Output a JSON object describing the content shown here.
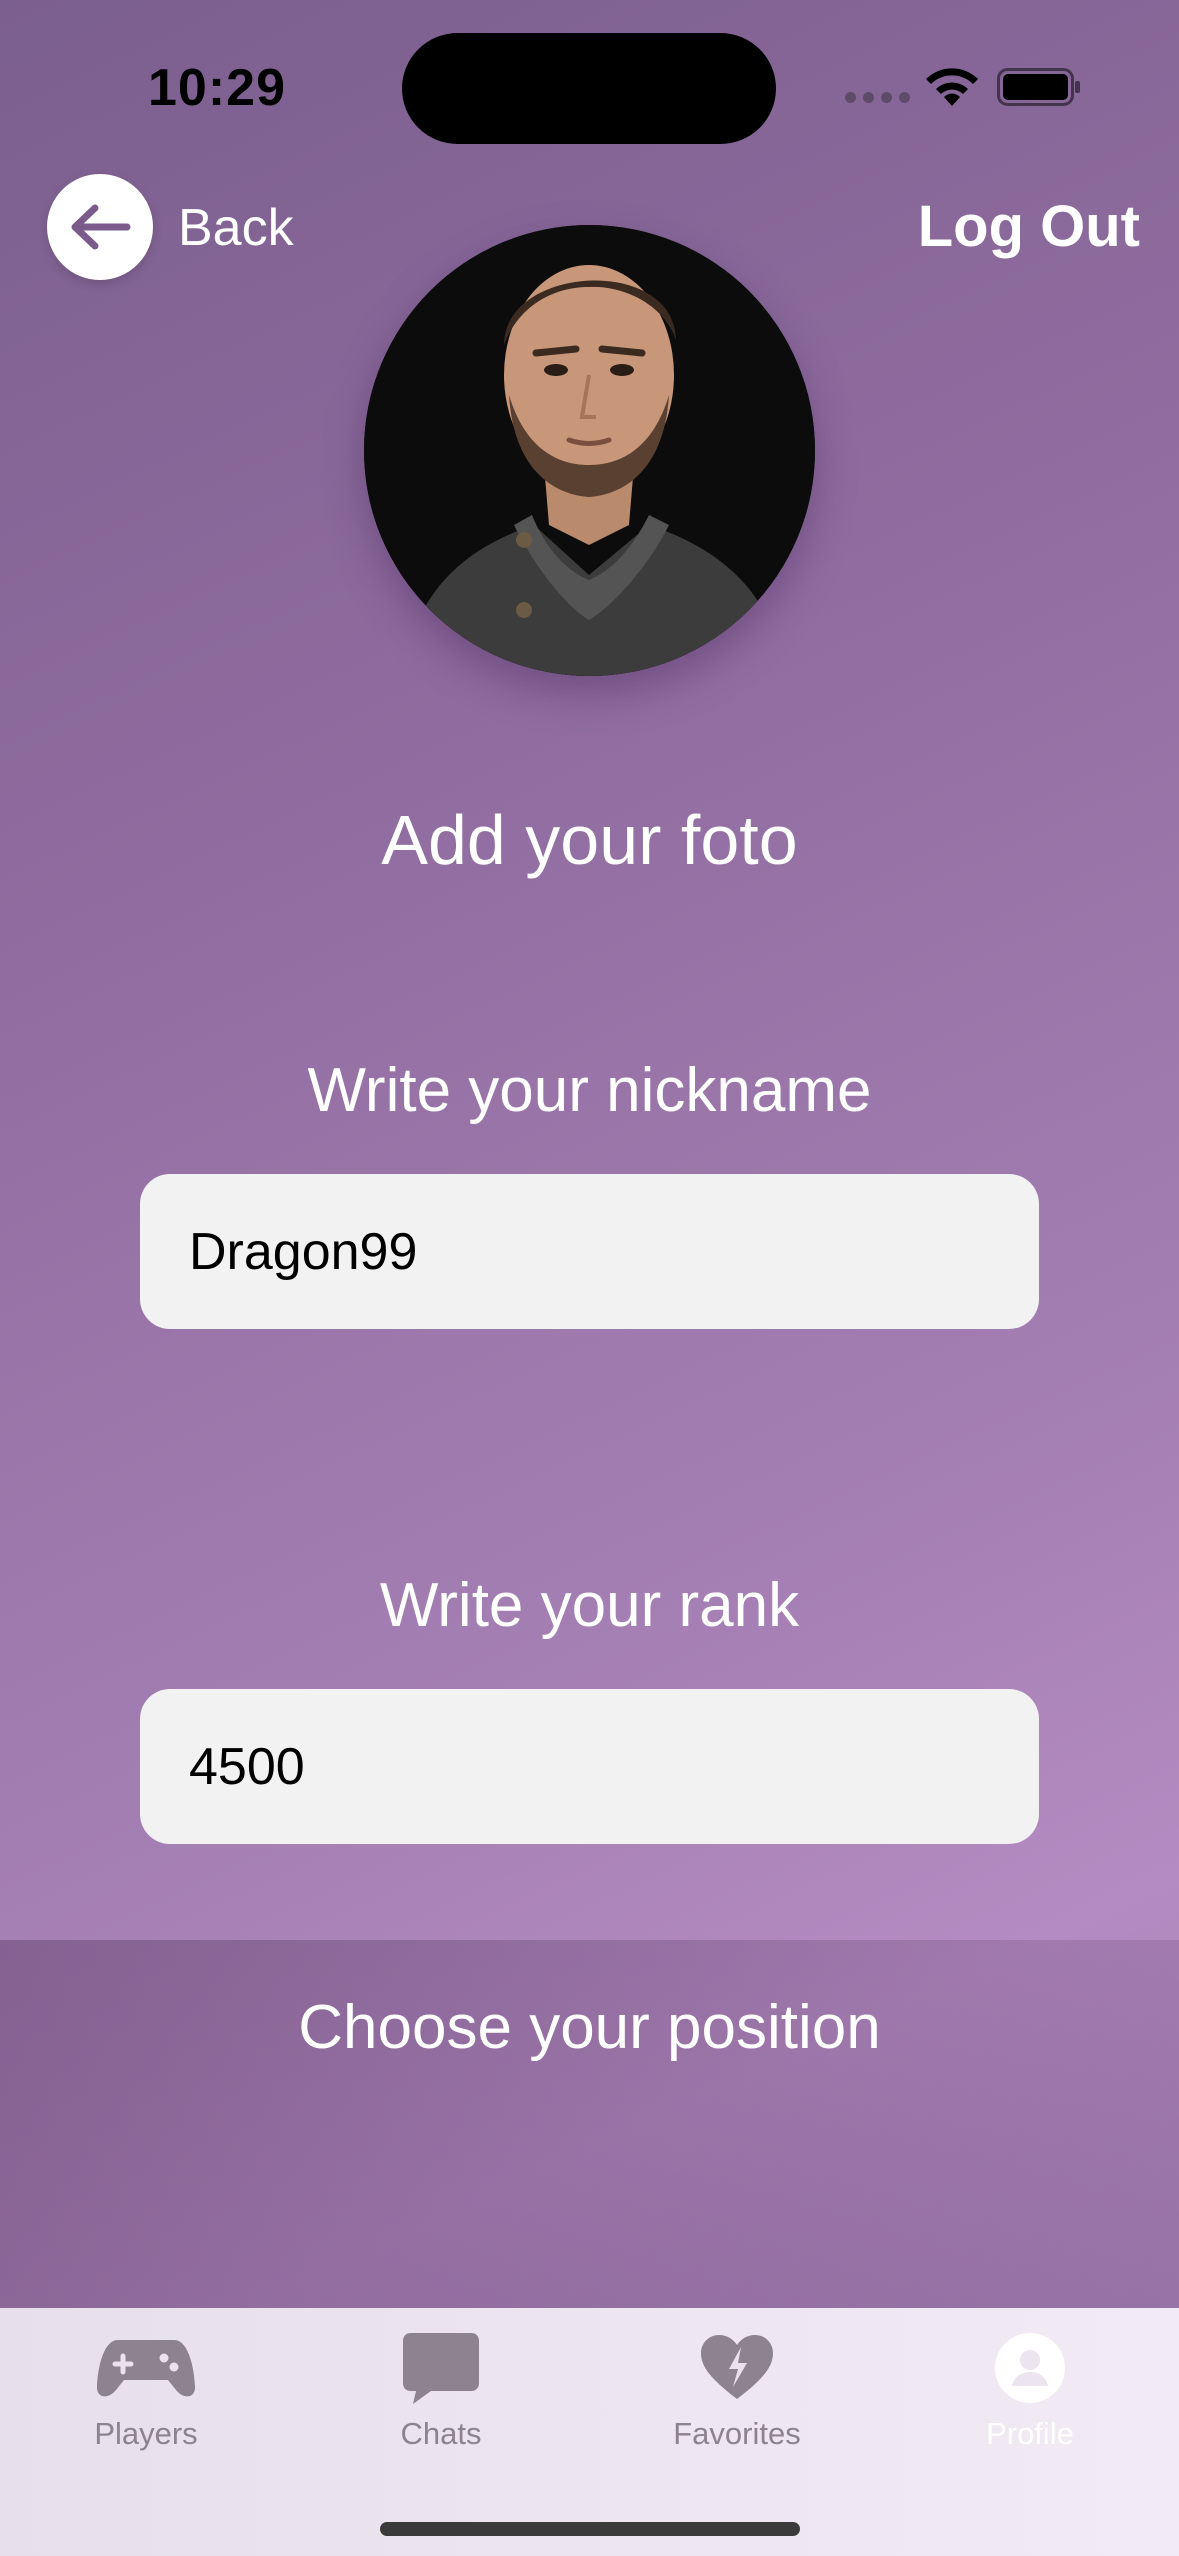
{
  "status": {
    "time": "10:29"
  },
  "nav": {
    "back_label": "Back",
    "logout_label": "Log Out"
  },
  "profile": {
    "add_photo_label": "Add your foto",
    "nickname_label": "Write your nickname",
    "nickname_value": "Dragon99",
    "rank_label": "Write your rank",
    "rank_value": "4500",
    "position_label": "Choose your position"
  },
  "tabs": [
    {
      "label": "Players",
      "icon": "gamepad-icon"
    },
    {
      "label": "Chats",
      "icon": "chat-bubble-icon"
    },
    {
      "label": "Favorites",
      "icon": "heart-bolt-icon"
    },
    {
      "label": "Profile",
      "icon": "person-icon"
    }
  ],
  "colors": {
    "accent_purple": "#9b79ad",
    "tab_inactive": "#8d838f",
    "tab_active": "#ffffff"
  }
}
